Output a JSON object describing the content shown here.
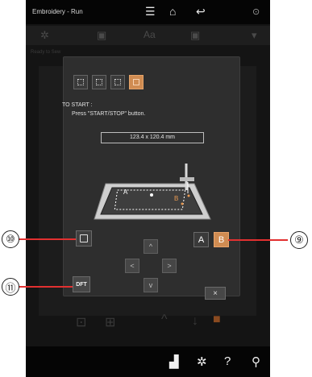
{
  "app": {
    "title": "Embroidery - Run"
  },
  "topbar_icons": [
    "menu-icon",
    "home-icon",
    "return-icon",
    "wifi-icon"
  ],
  "background": {
    "status_text": "Ready to Sew"
  },
  "dialog": {
    "to_start_title": "TO START :",
    "to_start_instruction": "Press \"START/STOP\" button.",
    "size_value": "123.4 x 120.4 mm",
    "hoop_labels": {
      "a": "A",
      "b": "B"
    },
    "buttons": {
      "dft": "DFT",
      "a": "A",
      "b": "B",
      "close": "×"
    },
    "arrows": {
      "up": "^",
      "left": "<",
      "right": ">",
      "down": "v"
    }
  },
  "callouts": {
    "c9": "⑨",
    "c10": "⑩",
    "c11": "⑪"
  },
  "bottombar_icons": [
    "thread-icon",
    "settings-icon",
    "help-icon",
    "tool-icon"
  ],
  "colors": {
    "accent": "#d08c52",
    "leader": "#e23030",
    "dialog_bg": "#2e2e2e"
  }
}
